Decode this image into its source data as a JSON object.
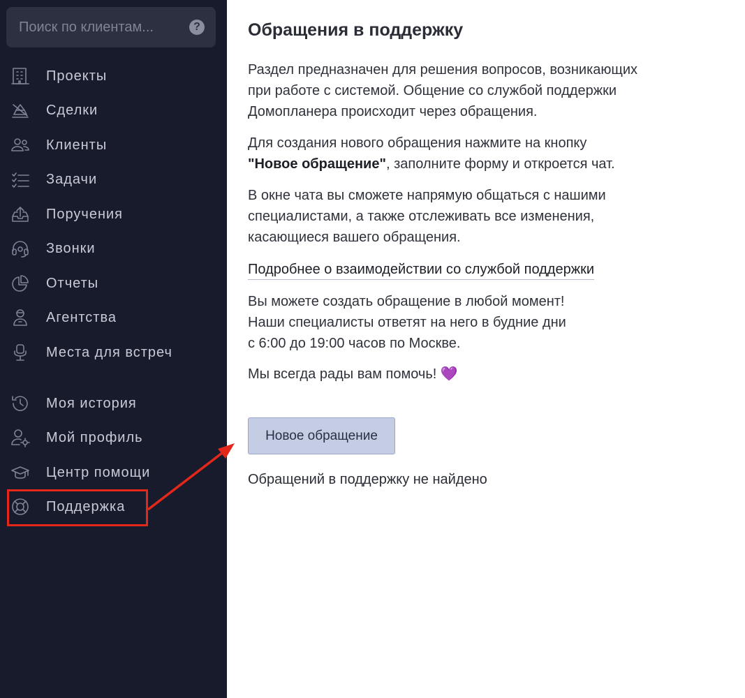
{
  "sidebar": {
    "search": {
      "placeholder": "Поиск по клиентам...",
      "help_icon": "question-circle-icon",
      "help_glyph": "?"
    },
    "items": [
      {
        "label": "Проекты",
        "icon": "building-icon"
      },
      {
        "label": "Сделки",
        "icon": "deal-icon"
      },
      {
        "label": "Клиенты",
        "icon": "users-icon"
      },
      {
        "label": "Задачи",
        "icon": "checklist-icon"
      },
      {
        "label": "Поручения",
        "icon": "upload-tray-icon"
      },
      {
        "label": "Звонки",
        "icon": "headset-icon"
      },
      {
        "label": "Отчеты",
        "icon": "pie-chart-icon"
      },
      {
        "label": "Агентства",
        "icon": "agent-icon"
      },
      {
        "label": "Места для встреч",
        "icon": "meeting-place-icon"
      },
      {
        "label": "Моя история",
        "icon": "history-icon"
      },
      {
        "label": "Мой профиль",
        "icon": "user-settings-icon"
      },
      {
        "label": "Центр помощи",
        "icon": "graduation-cap-icon"
      },
      {
        "label": "Поддержка",
        "icon": "lifebuoy-icon"
      }
    ],
    "highlighted_item": "Поддержка"
  },
  "main": {
    "title": "Обращения в поддержку",
    "intro": [
      "Раздел предназначен для решения вопросов, возникающих",
      "при работе с системой. Общение со службой поддержки",
      "Домопланера происходит через обращения."
    ],
    "create_line1": "Для создания нового обращения нажмите на кнопку",
    "create_bold": "\"Новое обращение\"",
    "create_rest": ", заполните форму и откроется чат.",
    "chat": [
      "В окне чата вы сможете напрямую общаться с нашими",
      "специалистами, а также отслеживать все изменения,",
      "касающиеся вашего обращения."
    ],
    "link": "Подробнее о взаимодействии со службой поддержки",
    "hours": [
      "Вы можете создать обращение в любой момент!",
      "Наши специалисты ответят на него в будние дни",
      "с 6:00 до 19:00 часов по Москве."
    ],
    "welcome": "Мы всегда рады вам помочь! ",
    "welcome_emoji": "💜",
    "new_button": "Новое обращение",
    "empty_state": "Обращений в поддержку не найдено"
  },
  "colors": {
    "sidebar_bg": "#181b2c",
    "highlight": "#e3281b",
    "button_bg": "#c5cde5"
  }
}
